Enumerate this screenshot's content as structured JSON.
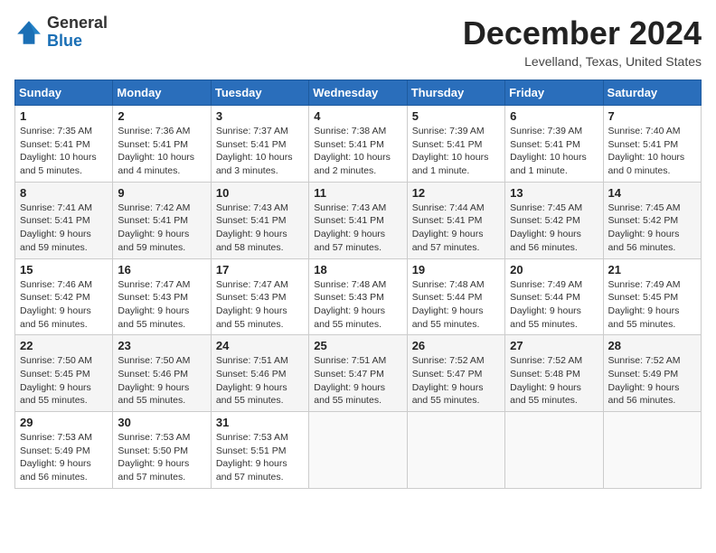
{
  "header": {
    "logo_line1": "General",
    "logo_line2": "Blue",
    "title": "December 2024",
    "location": "Levelland, Texas, United States"
  },
  "weekdays": [
    "Sunday",
    "Monday",
    "Tuesday",
    "Wednesday",
    "Thursday",
    "Friday",
    "Saturday"
  ],
  "weeks": [
    [
      {
        "day": "1",
        "sunrise": "Sunrise: 7:35 AM",
        "sunset": "Sunset: 5:41 PM",
        "daylight": "Daylight: 10 hours and 5 minutes."
      },
      {
        "day": "2",
        "sunrise": "Sunrise: 7:36 AM",
        "sunset": "Sunset: 5:41 PM",
        "daylight": "Daylight: 10 hours and 4 minutes."
      },
      {
        "day": "3",
        "sunrise": "Sunrise: 7:37 AM",
        "sunset": "Sunset: 5:41 PM",
        "daylight": "Daylight: 10 hours and 3 minutes."
      },
      {
        "day": "4",
        "sunrise": "Sunrise: 7:38 AM",
        "sunset": "Sunset: 5:41 PM",
        "daylight": "Daylight: 10 hours and 2 minutes."
      },
      {
        "day": "5",
        "sunrise": "Sunrise: 7:39 AM",
        "sunset": "Sunset: 5:41 PM",
        "daylight": "Daylight: 10 hours and 1 minute."
      },
      {
        "day": "6",
        "sunrise": "Sunrise: 7:39 AM",
        "sunset": "Sunset: 5:41 PM",
        "daylight": "Daylight: 10 hours and 1 minute."
      },
      {
        "day": "7",
        "sunrise": "Sunrise: 7:40 AM",
        "sunset": "Sunset: 5:41 PM",
        "daylight": "Daylight: 10 hours and 0 minutes."
      }
    ],
    [
      {
        "day": "8",
        "sunrise": "Sunrise: 7:41 AM",
        "sunset": "Sunset: 5:41 PM",
        "daylight": "Daylight: 9 hours and 59 minutes."
      },
      {
        "day": "9",
        "sunrise": "Sunrise: 7:42 AM",
        "sunset": "Sunset: 5:41 PM",
        "daylight": "Daylight: 9 hours and 59 minutes."
      },
      {
        "day": "10",
        "sunrise": "Sunrise: 7:43 AM",
        "sunset": "Sunset: 5:41 PM",
        "daylight": "Daylight: 9 hours and 58 minutes."
      },
      {
        "day": "11",
        "sunrise": "Sunrise: 7:43 AM",
        "sunset": "Sunset: 5:41 PM",
        "daylight": "Daylight: 9 hours and 57 minutes."
      },
      {
        "day": "12",
        "sunrise": "Sunrise: 7:44 AM",
        "sunset": "Sunset: 5:41 PM",
        "daylight": "Daylight: 9 hours and 57 minutes."
      },
      {
        "day": "13",
        "sunrise": "Sunrise: 7:45 AM",
        "sunset": "Sunset: 5:42 PM",
        "daylight": "Daylight: 9 hours and 56 minutes."
      },
      {
        "day": "14",
        "sunrise": "Sunrise: 7:45 AM",
        "sunset": "Sunset: 5:42 PM",
        "daylight": "Daylight: 9 hours and 56 minutes."
      }
    ],
    [
      {
        "day": "15",
        "sunrise": "Sunrise: 7:46 AM",
        "sunset": "Sunset: 5:42 PM",
        "daylight": "Daylight: 9 hours and 56 minutes."
      },
      {
        "day": "16",
        "sunrise": "Sunrise: 7:47 AM",
        "sunset": "Sunset: 5:43 PM",
        "daylight": "Daylight: 9 hours and 55 minutes."
      },
      {
        "day": "17",
        "sunrise": "Sunrise: 7:47 AM",
        "sunset": "Sunset: 5:43 PM",
        "daylight": "Daylight: 9 hours and 55 minutes."
      },
      {
        "day": "18",
        "sunrise": "Sunrise: 7:48 AM",
        "sunset": "Sunset: 5:43 PM",
        "daylight": "Daylight: 9 hours and 55 minutes."
      },
      {
        "day": "19",
        "sunrise": "Sunrise: 7:48 AM",
        "sunset": "Sunset: 5:44 PM",
        "daylight": "Daylight: 9 hours and 55 minutes."
      },
      {
        "day": "20",
        "sunrise": "Sunrise: 7:49 AM",
        "sunset": "Sunset: 5:44 PM",
        "daylight": "Daylight: 9 hours and 55 minutes."
      },
      {
        "day": "21",
        "sunrise": "Sunrise: 7:49 AM",
        "sunset": "Sunset: 5:45 PM",
        "daylight": "Daylight: 9 hours and 55 minutes."
      }
    ],
    [
      {
        "day": "22",
        "sunrise": "Sunrise: 7:50 AM",
        "sunset": "Sunset: 5:45 PM",
        "daylight": "Daylight: 9 hours and 55 minutes."
      },
      {
        "day": "23",
        "sunrise": "Sunrise: 7:50 AM",
        "sunset": "Sunset: 5:46 PM",
        "daylight": "Daylight: 9 hours and 55 minutes."
      },
      {
        "day": "24",
        "sunrise": "Sunrise: 7:51 AM",
        "sunset": "Sunset: 5:46 PM",
        "daylight": "Daylight: 9 hours and 55 minutes."
      },
      {
        "day": "25",
        "sunrise": "Sunrise: 7:51 AM",
        "sunset": "Sunset: 5:47 PM",
        "daylight": "Daylight: 9 hours and 55 minutes."
      },
      {
        "day": "26",
        "sunrise": "Sunrise: 7:52 AM",
        "sunset": "Sunset: 5:47 PM",
        "daylight": "Daylight: 9 hours and 55 minutes."
      },
      {
        "day": "27",
        "sunrise": "Sunrise: 7:52 AM",
        "sunset": "Sunset: 5:48 PM",
        "daylight": "Daylight: 9 hours and 55 minutes."
      },
      {
        "day": "28",
        "sunrise": "Sunrise: 7:52 AM",
        "sunset": "Sunset: 5:49 PM",
        "daylight": "Daylight: 9 hours and 56 minutes."
      }
    ],
    [
      {
        "day": "29",
        "sunrise": "Sunrise: 7:53 AM",
        "sunset": "Sunset: 5:49 PM",
        "daylight": "Daylight: 9 hours and 56 minutes."
      },
      {
        "day": "30",
        "sunrise": "Sunrise: 7:53 AM",
        "sunset": "Sunset: 5:50 PM",
        "daylight": "Daylight: 9 hours and 57 minutes."
      },
      {
        "day": "31",
        "sunrise": "Sunrise: 7:53 AM",
        "sunset": "Sunset: 5:51 PM",
        "daylight": "Daylight: 9 hours and 57 minutes."
      },
      null,
      null,
      null,
      null
    ]
  ]
}
